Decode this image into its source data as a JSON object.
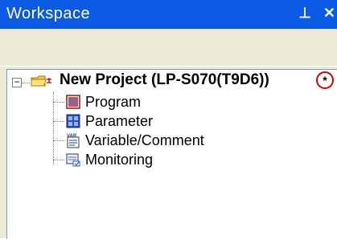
{
  "window": {
    "title": "Workspace",
    "pin_glyph": "⊥",
    "close_glyph": "✕"
  },
  "tree": {
    "root": {
      "expander": "−",
      "icon": "project-folder-icon",
      "label": "New Project (LP-S070(T9D6))",
      "mark": "*"
    },
    "children": [
      {
        "icon": "program-icon",
        "label": "Program"
      },
      {
        "icon": "parameter-icon",
        "label": "Parameter"
      },
      {
        "icon": "variable-comment-icon",
        "label": "Variable/Comment"
      },
      {
        "icon": "monitoring-icon",
        "label": "Monitoring"
      }
    ]
  },
  "colors": {
    "titlebar": "#0a5ae3",
    "highlight_circle": "#e00000"
  }
}
